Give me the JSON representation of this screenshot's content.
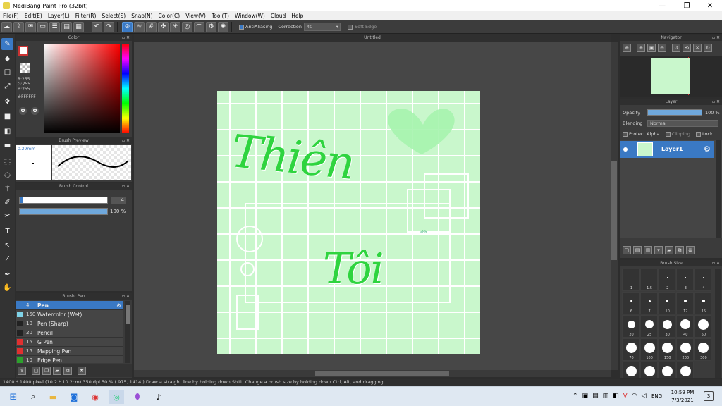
{
  "window": {
    "title": "MediBang Paint Pro (32bit)",
    "minimize": "—",
    "maximize": "❐",
    "close": "✕"
  },
  "menu": [
    "File(F)",
    "Edit(E)",
    "Layer(L)",
    "Filter(R)",
    "Select(S)",
    "Snap(N)",
    "Color(C)",
    "View(V)",
    "Tool(T)",
    "Window(W)",
    "Cloud",
    "Help"
  ],
  "toolbar": {
    "antialias_label": "AntiAliasing",
    "correction_label": "Correction",
    "correction_value": "40",
    "soft_edge_label": "Soft Edge"
  },
  "color_panel": {
    "title": "Color",
    "r": "R:255",
    "g": "G:255",
    "b": "B:255",
    "hex": "#FFFFFF"
  },
  "brush_preview": {
    "title": "Brush Preview",
    "size": "0.29mm"
  },
  "brush_control": {
    "title": "Brush Control",
    "size_value": "4",
    "opacity_value": "100 %"
  },
  "brush_list": {
    "title": "Brush: Pen",
    "items": [
      {
        "num": "4",
        "name": "Pen",
        "color": "#3a79c4"
      },
      {
        "num": "150",
        "name": "Watercolor (Wet)",
        "color": "#7fd3e8"
      },
      {
        "num": "10",
        "name": "Pen (Sharp)",
        "color": "#222222"
      },
      {
        "num": "20",
        "name": "Pencil",
        "color": "#222222"
      },
      {
        "num": "15",
        "name": "G Pen",
        "color": "#e03030"
      },
      {
        "num": "15",
        "name": "Mapping Pen",
        "color": "#e03030"
      },
      {
        "num": "10",
        "name": "Edge Pen",
        "color": "#2ca02c"
      }
    ]
  },
  "canvas": {
    "title": "Untitled"
  },
  "artwork": {
    "word1": "Thiên",
    "word2": "Tôi",
    "small_text": "ahh..."
  },
  "navigator": {
    "title": "Navigator"
  },
  "layer_panel": {
    "title": "Layer",
    "opacity_label": "Opacity",
    "opacity_value": "100 %",
    "blending_label": "Blending",
    "blending_value": "Normal",
    "protect_alpha": "Protect Alpha",
    "clipping": "Clipping",
    "lock": "Lock",
    "layer_name": "Layer1"
  },
  "brush_size": {
    "title": "Brush Size",
    "labels": [
      "1",
      "1.5",
      "2",
      "3",
      "4",
      "6",
      "7",
      "10",
      "12",
      "15",
      "20",
      "25",
      "30",
      "40",
      "50",
      "70",
      "100",
      "150",
      "200",
      "300"
    ]
  },
  "status": {
    "text": "1400 * 1400 pixel   (10.2 * 10.2cm)   350 dpi   50 %   ( 975, 1414 )   Draw a straight line by holding down Shift, Change a brush size by holding down Ctrl, Alt, and dragging"
  },
  "taskbar": {
    "lang": "ENG",
    "time": "10:59 PM",
    "date": "7/3/2021",
    "notifications": "3"
  }
}
